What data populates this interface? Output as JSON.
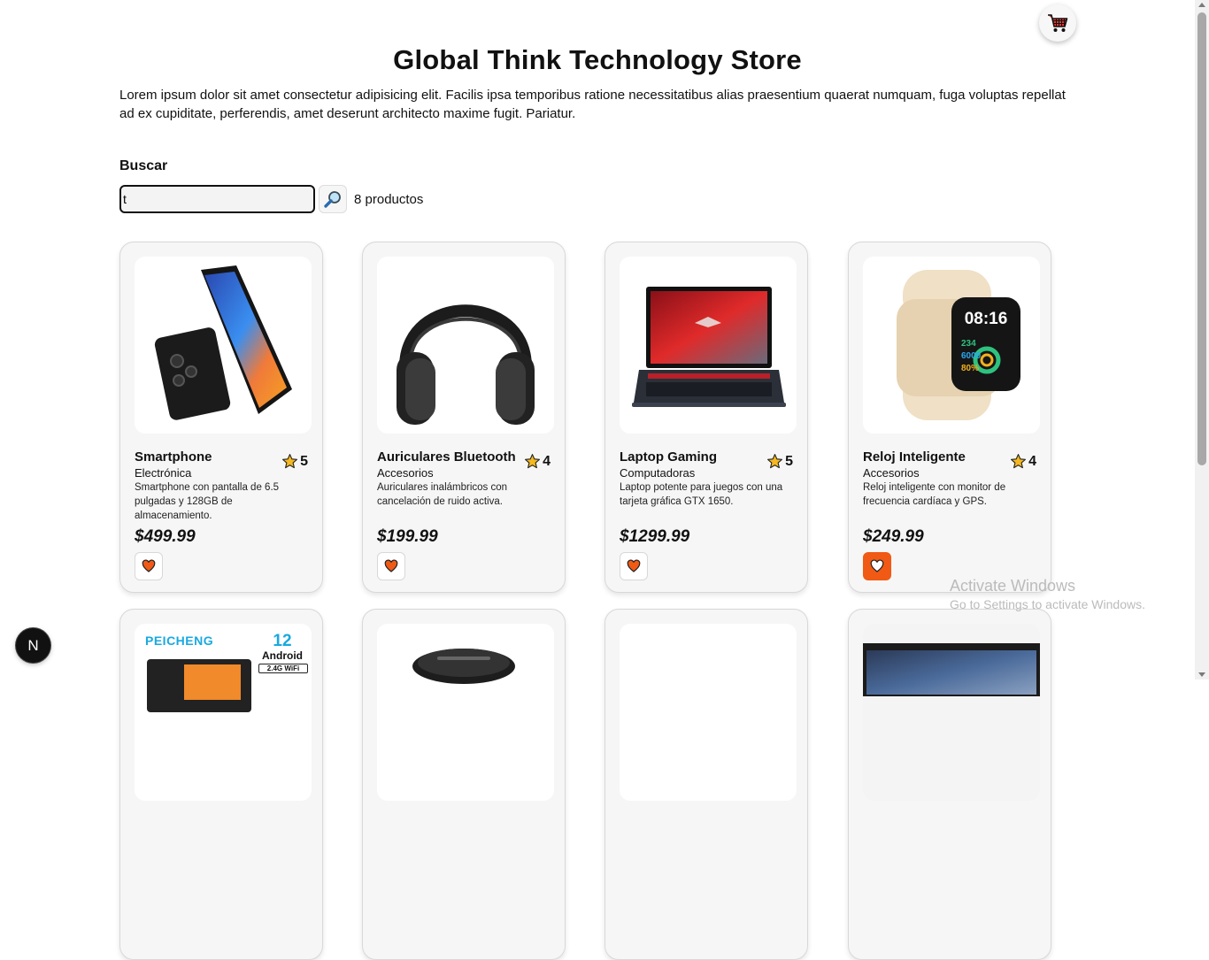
{
  "store": {
    "title": "Global Think Technology Store",
    "description": "Lorem ipsum dolor sit amet consectetur adipisicing elit. Facilis ipsa temporibus ratione necessitatibus alias praesentium quaerat numquam, fuga voluptas repellat ad ex cupiditate, perferendis, amet deserunt architecto maxime fugit. Pariatur."
  },
  "search": {
    "label": "Buscar",
    "value": "t",
    "placeholder": "",
    "count_text": "8 productos",
    "button_icon": "search-magnifier-icon"
  },
  "cart": {
    "icon": "shopping-cart-icon"
  },
  "products": [
    {
      "name": "Smartphone",
      "category": "Electrónica",
      "description": "Smartphone con pantalla de 6.5 pulgadas y 128GB de almacenamiento.",
      "price": "$499.99",
      "rating": "5",
      "favorite": false,
      "image": "smartphone"
    },
    {
      "name": "Auriculares Bluetooth",
      "category": "Accesorios",
      "description": "Auriculares inalámbricos con cancelación de ruido activa.",
      "price": "$199.99",
      "rating": "4",
      "favorite": false,
      "image": "headphones"
    },
    {
      "name": "Laptop Gaming",
      "category": "Computadoras",
      "description": "Laptop potente para juegos con una tarjeta gráfica GTX 1650.",
      "price": "$1299.99",
      "rating": "5",
      "favorite": false,
      "image": "laptop"
    },
    {
      "name": "Reloj Inteligente",
      "category": "Accesorios",
      "description": "Reloj inteligente con monitor de frecuencia cardíaca y GPS.",
      "price": "$249.99",
      "rating": "4",
      "favorite": true,
      "image": "smartwatch",
      "watch_time": "08:16",
      "watch_stats": [
        "234",
        "6000",
        "80%"
      ]
    },
    {
      "image": "tablet",
      "brand_text": "PEICHENG",
      "badge_number": "12",
      "badge_text": "Android",
      "badge_sub": "2.4G WiFi"
    },
    {
      "image": "speaker"
    },
    {
      "image": "blank"
    },
    {
      "image": "monitor"
    }
  ],
  "framework_badge": {
    "letter": "N"
  },
  "watermark": {
    "title": "Activate Windows",
    "subtitle": "Go to Settings to activate Windows."
  },
  "colors": {
    "accent": "#f05a14",
    "star": "#f5b820",
    "card_bg": "#f6f6f6"
  }
}
